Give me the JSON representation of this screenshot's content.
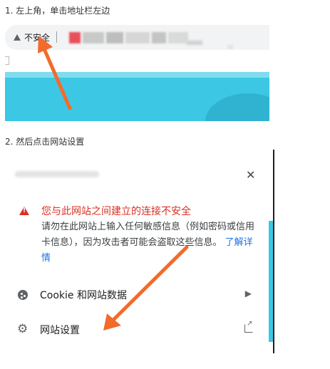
{
  "steps": {
    "step1": "1. 左上角，单击地址栏左边",
    "step2": "2. 然后点击网站设置"
  },
  "address_bar": {
    "security_chip_label": "不安全",
    "security_icon": "warning-triangle-icon"
  },
  "site_info_popup": {
    "close_icon": "close-icon",
    "warning_title": "您与此网站之间建立的连接不安全",
    "warning_description": "请勿在此网站上输入任何敏感信息（例如密码或信用卡信息），因为攻击者可能会盗取这些信息。",
    "learn_more_link": "了解详情",
    "menu": [
      {
        "label": "Cookie 和网站数据",
        "icon": "cookie-icon",
        "trailing": "chevron-right-icon"
      },
      {
        "label": "网站设置",
        "icon": "gear-icon",
        "trailing": "open-external-icon"
      }
    ]
  },
  "colors": {
    "warning_red": "#d93025",
    "link_blue": "#1a73e8",
    "annotation_orange": "#f26b2a",
    "banner_cyan": "#3cc7e4"
  }
}
